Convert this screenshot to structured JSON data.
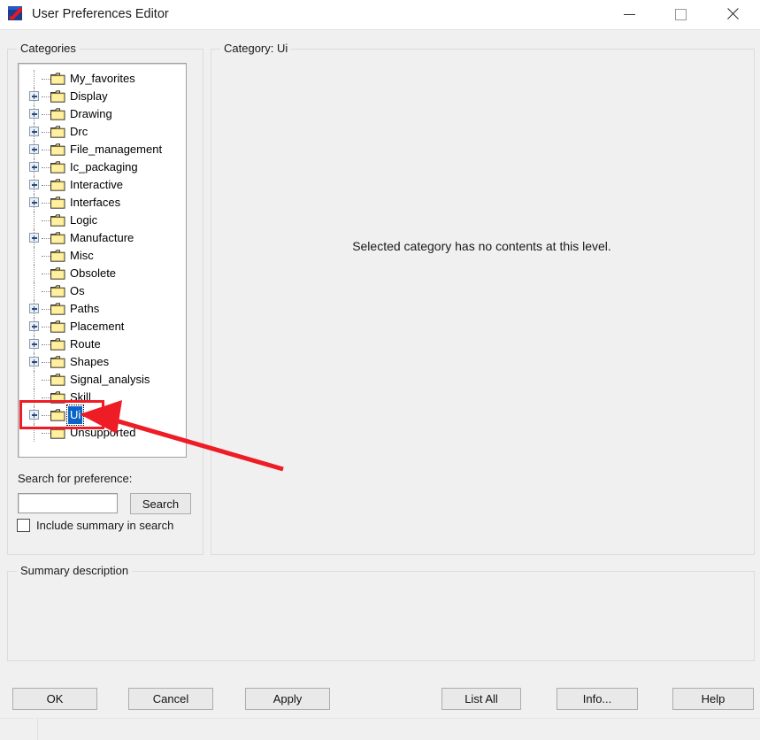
{
  "window": {
    "title": "User Preferences Editor",
    "app_icon": "cadence-app-icon",
    "controls": {
      "minimize": "minimize-icon",
      "maximize": "maximize-icon",
      "close": "close-icon"
    }
  },
  "categories_panel": {
    "legend": "Categories",
    "tree": [
      {
        "label": "My_favorites",
        "expandable": false,
        "selected": false
      },
      {
        "label": "Display",
        "expandable": true,
        "selected": false
      },
      {
        "label": "Drawing",
        "expandable": true,
        "selected": false
      },
      {
        "label": "Drc",
        "expandable": true,
        "selected": false
      },
      {
        "label": "File_management",
        "expandable": true,
        "selected": false
      },
      {
        "label": "Ic_packaging",
        "expandable": true,
        "selected": false
      },
      {
        "label": "Interactive",
        "expandable": true,
        "selected": false
      },
      {
        "label": "Interfaces",
        "expandable": true,
        "selected": false
      },
      {
        "label": "Logic",
        "expandable": false,
        "selected": false
      },
      {
        "label": "Manufacture",
        "expandable": true,
        "selected": false
      },
      {
        "label": "Misc",
        "expandable": false,
        "selected": false
      },
      {
        "label": "Obsolete",
        "expandable": false,
        "selected": false
      },
      {
        "label": "Os",
        "expandable": false,
        "selected": false
      },
      {
        "label": "Paths",
        "expandable": true,
        "selected": false
      },
      {
        "label": "Placement",
        "expandable": true,
        "selected": false
      },
      {
        "label": "Route",
        "expandable": true,
        "selected": false
      },
      {
        "label": "Shapes",
        "expandable": true,
        "selected": false
      },
      {
        "label": "Signal_analysis",
        "expandable": false,
        "selected": false
      },
      {
        "label": "Skill",
        "expandable": false,
        "selected": false
      },
      {
        "label": "Ui",
        "expandable": true,
        "selected": true
      },
      {
        "label": "Unsupported",
        "expandable": false,
        "selected": false
      }
    ],
    "search": {
      "label": "Search for preference:",
      "value": "",
      "placeholder": "",
      "button": "Search",
      "checkbox_label": "Include summary in search",
      "checkbox_checked": false
    }
  },
  "category_panel": {
    "legend": "Category:  Ui",
    "message": "Selected category has no contents at this level."
  },
  "summary_panel": {
    "legend": "Summary description",
    "content": ""
  },
  "buttons": {
    "ok": "OK",
    "cancel": "Cancel",
    "apply": "Apply",
    "list_all": "List All",
    "info": "Info...",
    "help": "Help"
  },
  "annotations": {
    "highlight_color": "#ee1c25",
    "highlight_target": "Ui",
    "arrow": "pointer-arrow"
  },
  "colors": {
    "selection": "#0a64c8",
    "folder": "#ffe680",
    "panel_bg": "#f0f0f0"
  }
}
